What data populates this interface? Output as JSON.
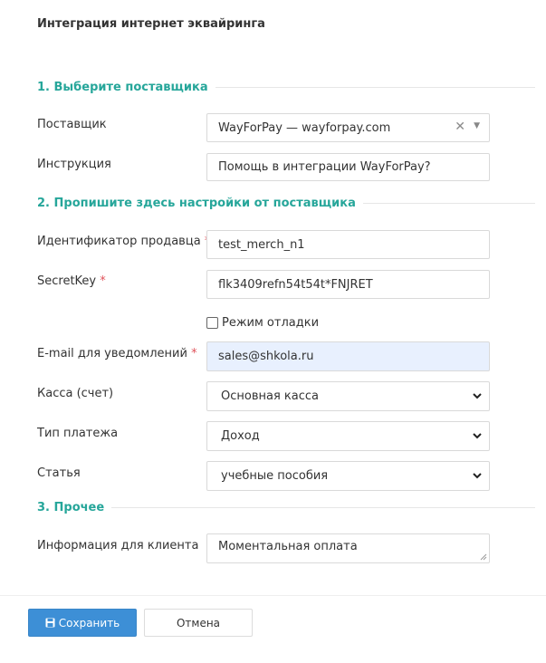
{
  "dialog": {
    "title": "Интеграция интернет эквайринга"
  },
  "sections": {
    "s1": "1. Выберите поставщика",
    "s2": "2. Пропишите здесь настройки от поставщика",
    "s3": "3. Прочее"
  },
  "provider": {
    "label": "Поставщик",
    "value": "WayForPay — wayforpay.com",
    "clear": "✕",
    "caret": "▼"
  },
  "instruction": {
    "label": "Инструкция",
    "value": "Помощь в интеграции WayForPay?"
  },
  "merchant_id": {
    "label": "Идентификатор продавца",
    "required": "*",
    "value": "test_merch_n1"
  },
  "secret_key": {
    "label": "SecretKey",
    "required": "*",
    "value": "flk3409refn54t54t*FNJRET"
  },
  "debug_mode": {
    "label": "Режим отладки",
    "checked": false
  },
  "email": {
    "label": "E-mail для уведомлений",
    "required": "*",
    "value": "sales@shkola.ru"
  },
  "cashbox": {
    "label": "Касса (счет)",
    "value": "Основная касса"
  },
  "payment_type": {
    "label": "Тип платежа",
    "value": "Доход"
  },
  "article": {
    "label": "Статья",
    "value": "учебные пособия"
  },
  "client_info": {
    "label": "Информация для клиента",
    "value": "Моментальная оплата"
  },
  "buttons": {
    "save": "Сохранить",
    "cancel": "Отмена"
  },
  "colors": {
    "accent": "#26a69a",
    "primary": "#3d8fd6",
    "required": "#e0525a",
    "autofill": "#e8f0fe"
  }
}
